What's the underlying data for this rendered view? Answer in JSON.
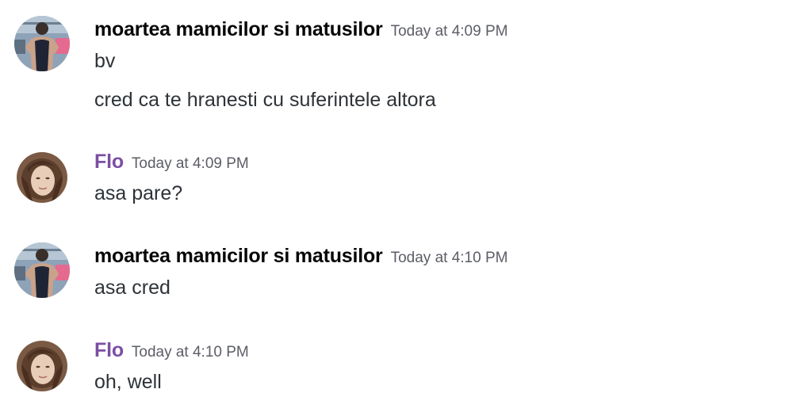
{
  "messages": [
    {
      "author": "moartea mamicilor si matusilor",
      "timestamp": "Today at 4:09 PM",
      "lines": [
        "bv",
        "cred ca te hranesti cu suferintele altora"
      ]
    },
    {
      "author": "Flo",
      "timestamp": "Today at 4:09 PM",
      "lines": [
        "asa pare?"
      ]
    },
    {
      "author": "moartea mamicilor si matusilor",
      "timestamp": "Today at 4:10 PM",
      "lines": [
        "asa cred"
      ]
    },
    {
      "author": "Flo",
      "timestamp": "Today at 4:10 PM",
      "lines": [
        "oh, well"
      ]
    }
  ],
  "colors": {
    "author_default": "#060607",
    "author_flo": "#7b4ea3",
    "timestamp": "#5c5e66",
    "message_text": "#2e3338"
  },
  "icons": {
    "avatar_1": "gym-back-photo-avatar",
    "avatar_2": "woman-portrait-avatar"
  }
}
